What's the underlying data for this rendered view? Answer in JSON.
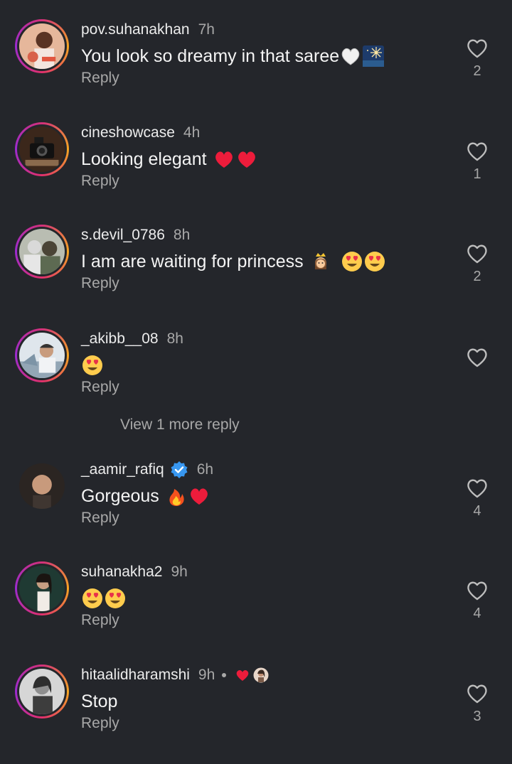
{
  "comments": [
    {
      "username": "pov.suhanakhan",
      "time": "7h",
      "text": "You look so dreamy in that saree",
      "emojis": [
        "white-heart",
        "fireworks"
      ],
      "reply_label": "Reply",
      "likes": "2",
      "has_story": true,
      "avatar_colors": [
        "#c8735a",
        "#e9b79a"
      ]
    },
    {
      "username": "cineshowcase",
      "time": "4h",
      "text": "Looking elegant",
      "emojis": [
        "red-heart",
        "red-heart"
      ],
      "reply_label": "Reply",
      "likes": "1",
      "has_story": true,
      "avatar_colors": [
        "#2a1a12",
        "#6d5138"
      ]
    },
    {
      "username": "s.devil_0786",
      "time": "8h",
      "text": "I am are waiting for princess",
      "emojis": [
        "crown-face",
        "heart-eyes",
        "heart-eyes"
      ],
      "reply_label": "Reply",
      "likes": "2",
      "has_story": true,
      "avatar_colors": [
        "#8a8f7d",
        "#c9cbc2"
      ]
    },
    {
      "username": "_akibb__08",
      "time": "8h",
      "text": "",
      "emojis": [
        "heart-eyes"
      ],
      "reply_label": "Reply",
      "likes": "",
      "has_story": true,
      "avatar_colors": [
        "#6e8fa6",
        "#d8dee4"
      ]
    },
    {
      "username": "_aamir_rafiq",
      "time": "6h",
      "text": "Gorgeous",
      "emojis": [
        "fire",
        "red-heart"
      ],
      "reply_label": "Reply",
      "likes": "4",
      "has_story": false,
      "verified": true,
      "avatar_colors": [
        "#3a2e28",
        "#c79c80"
      ]
    },
    {
      "username": "suhanakha2",
      "time": "9h",
      "text": "",
      "emojis": [
        "heart-eyes",
        "heart-eyes"
      ],
      "reply_label": "Reply",
      "likes": "4",
      "has_story": true,
      "avatar_colors": [
        "#2f4a42",
        "#c7a58a"
      ]
    },
    {
      "username": "hitaalidharamshi",
      "time": "9h",
      "text": "Stop",
      "emojis": [],
      "reply_label": "Reply",
      "likes": "3",
      "has_story": true,
      "liked_by_creator": true,
      "avatar_colors": [
        "#3a3a3a",
        "#bdbdbd"
      ]
    }
  ],
  "view_more_replies": "View 1 more reply",
  "colors": {
    "background": "#24262b",
    "muted_text": "#a8a8a8",
    "verified": "#3897f0",
    "heart_red": "#ed1c3b"
  }
}
